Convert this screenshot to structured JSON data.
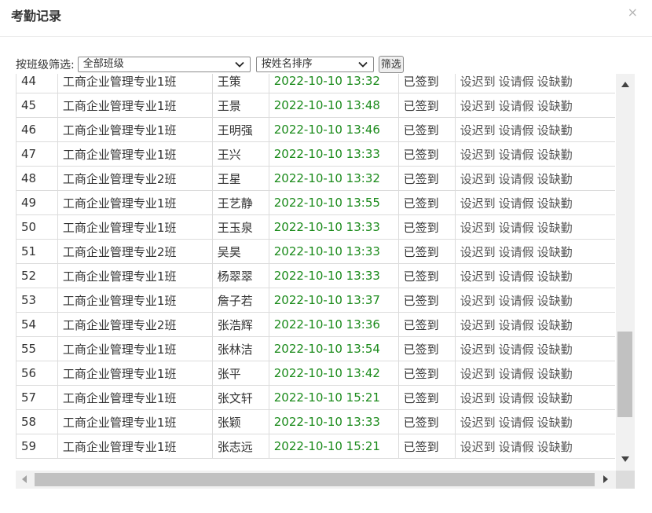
{
  "dialog": {
    "title": "考勤记录",
    "close_symbol": "×"
  },
  "filter": {
    "label": "按班级筛选:",
    "class_select": "全部班级",
    "sort_select": "按姓名排序",
    "button": "筛选"
  },
  "actions": [
    "设迟到",
    "设请假",
    "设缺勤"
  ],
  "rows": [
    {
      "no": "44",
      "class": "工商企业管理专业1班",
      "name": "王策",
      "time": "2022-10-10 13:32",
      "status": "已签到"
    },
    {
      "no": "45",
      "class": "工商企业管理专业1班",
      "name": "王景",
      "time": "2022-10-10 13:48",
      "status": "已签到"
    },
    {
      "no": "46",
      "class": "工商企业管理专业1班",
      "name": "王明强",
      "time": "2022-10-10 13:46",
      "status": "已签到"
    },
    {
      "no": "47",
      "class": "工商企业管理专业1班",
      "name": "王兴",
      "time": "2022-10-10 13:33",
      "status": "已签到"
    },
    {
      "no": "48",
      "class": "工商企业管理专业2班",
      "name": "王星",
      "time": "2022-10-10 13:32",
      "status": "已签到"
    },
    {
      "no": "49",
      "class": "工商企业管理专业1班",
      "name": "王艺静",
      "time": "2022-10-10 13:55",
      "status": "已签到"
    },
    {
      "no": "50",
      "class": "工商企业管理专业1班",
      "name": "王玉泉",
      "time": "2022-10-10 13:33",
      "status": "已签到"
    },
    {
      "no": "51",
      "class": "工商企业管理专业2班",
      "name": "吴昊",
      "time": "2022-10-10 13:33",
      "status": "已签到"
    },
    {
      "no": "52",
      "class": "工商企业管理专业1班",
      "name": "杨翠翠",
      "time": "2022-10-10 13:33",
      "status": "已签到"
    },
    {
      "no": "53",
      "class": "工商企业管理专业1班",
      "name": "詹子若",
      "time": "2022-10-10 13:37",
      "status": "已签到"
    },
    {
      "no": "54",
      "class": "工商企业管理专业2班",
      "name": "张浩辉",
      "time": "2022-10-10 13:36",
      "status": "已签到"
    },
    {
      "no": "55",
      "class": "工商企业管理专业1班",
      "name": "张林洁",
      "time": "2022-10-10 13:54",
      "status": "已签到"
    },
    {
      "no": "56",
      "class": "工商企业管理专业1班",
      "name": "张平",
      "time": "2022-10-10 13:42",
      "status": "已签到"
    },
    {
      "no": "57",
      "class": "工商企业管理专业1班",
      "name": "张文轩",
      "time": "2022-10-10 15:21",
      "status": "已签到"
    },
    {
      "no": "58",
      "class": "工商企业管理专业1班",
      "name": "张颖",
      "time": "2022-10-10 13:33",
      "status": "已签到"
    },
    {
      "no": "59",
      "class": "工商企业管理专业1班",
      "name": "张志远",
      "time": "2022-10-10 15:21",
      "status": "已签到"
    }
  ],
  "colors": {
    "time_text": "#1a8a1a",
    "border": "#dcdcdc",
    "scroll_thumb": "#c1c1c1"
  }
}
